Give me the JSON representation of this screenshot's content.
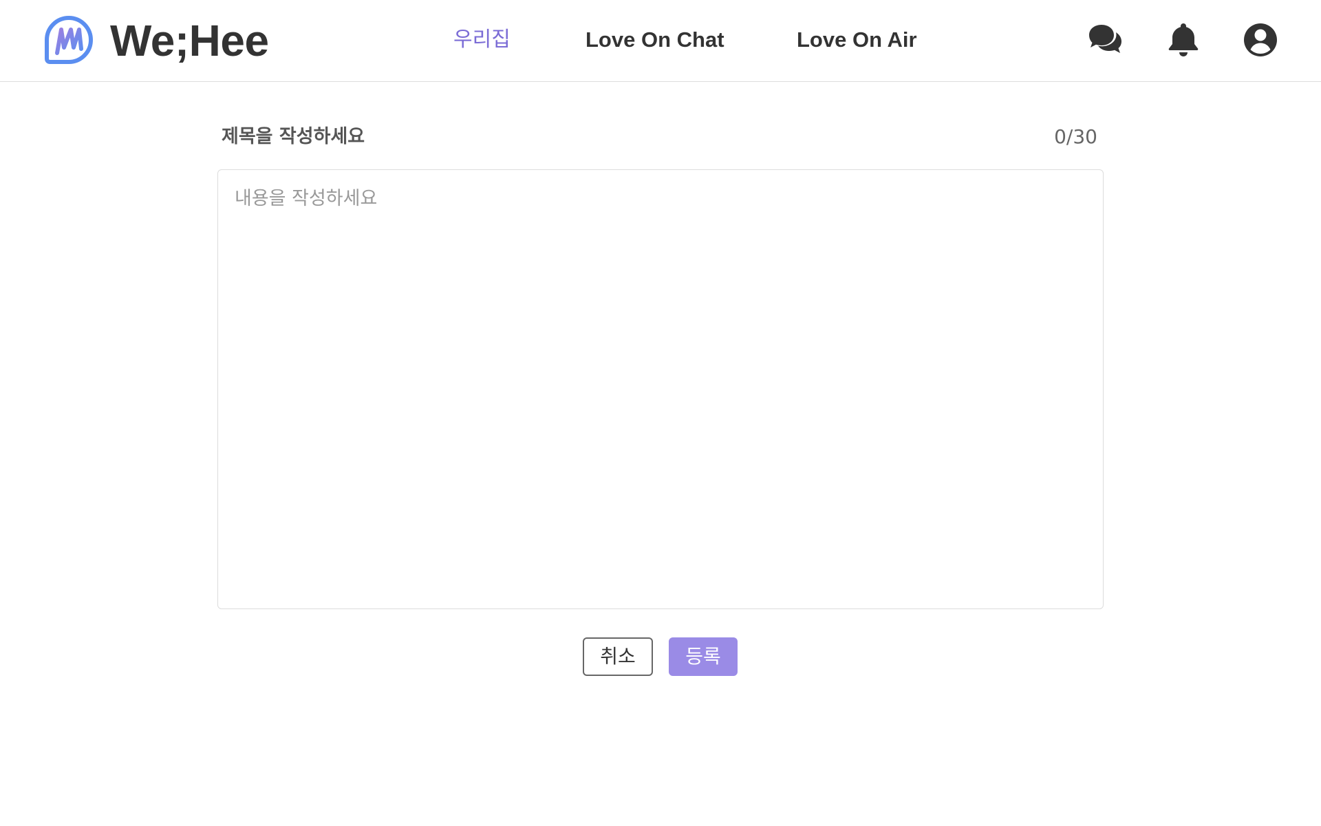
{
  "header": {
    "brand": "We;Hee",
    "logo_icon": "wehee-logo-icon",
    "nav": [
      {
        "label": "우리집",
        "active": true
      },
      {
        "label": "Love On Chat",
        "active": false
      },
      {
        "label": "Love On Air",
        "active": false
      }
    ],
    "icons": [
      "chat-icon",
      "bell-icon",
      "user-icon"
    ]
  },
  "editor": {
    "title_placeholder": "제목을 작성하세요",
    "title_value": "",
    "char_counter": "0/30",
    "content_placeholder": "내용을 작성하세요",
    "content_value": ""
  },
  "actions": {
    "cancel_label": "취소",
    "submit_label": "등록"
  },
  "colors": {
    "accent": "#7b6cd6",
    "submit_bg": "#9a8be6",
    "text": "#333333",
    "logo_blue": "#5b8ef0"
  }
}
